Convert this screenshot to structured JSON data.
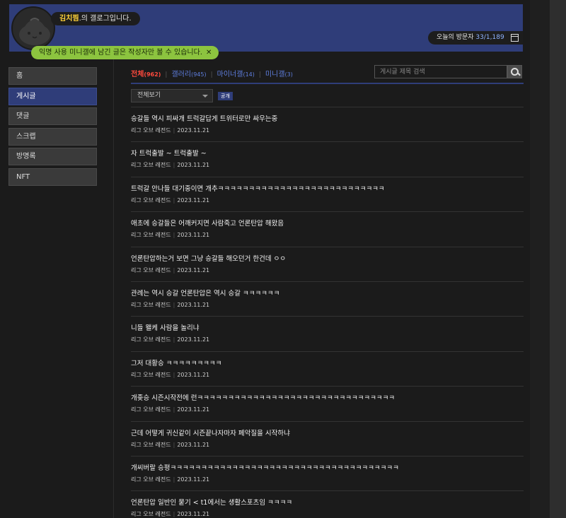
{
  "header": {
    "nickname": "김치찜",
    "gallog_suffix": ".의 갤로그입니다.",
    "visitor_label": "오늘의 방문자",
    "visitor_count": "33/1,189",
    "notice": "익명 사용 미니갤에 남긴 글은 작성자만 볼 수 있습니다.",
    "notice_close": "✕"
  },
  "nav": {
    "items": [
      {
        "label": "홈"
      },
      {
        "label": "게시글"
      },
      {
        "label": "댓글"
      },
      {
        "label": "스크랩"
      },
      {
        "label": "방명록"
      },
      {
        "label": "NFT"
      }
    ]
  },
  "tabs": [
    {
      "label": "전체",
      "count": "(962)"
    },
    {
      "label": "갤러리",
      "count": "(945)"
    },
    {
      "label": "마이너갤",
      "count": "(14)"
    },
    {
      "label": "미니갤",
      "count": "(3)"
    }
  ],
  "search": {
    "placeholder": "게시글 제목 검색"
  },
  "filter": {
    "selected": "전체보기",
    "badge": "공개"
  },
  "posts": [
    {
      "title": "승갈들 역시 피싸개 트럭갈답게 트위터로만 싸우는중",
      "gallery": "리그 오브 레전드",
      "date": "2023.11.21"
    },
    {
      "title": "자 트럭출발 ~ 트럭출발 ~",
      "gallery": "리그 오브 레전드",
      "date": "2023.11.21"
    },
    {
      "title": "트럭갈 안나들 대기중이면 개추ㅋㅋㅋㅋㅋㅋㅋㅋㅋㅋㅋㅋㅋㅋㅋㅋㅋㅋㅋㅋㅋㅋㅋㅋㅋㅋㅋ",
      "gallery": "리그 오브 레전드",
      "date": "2023.11.21"
    },
    {
      "title": "애초에 승갈들은 어깨커지면 사람죽고 언론탄압 해왔음",
      "gallery": "리그 오브 레전드",
      "date": "2023.11.21"
    },
    {
      "title": "언론탄압하는거 보면 그냥 승갈들 해오던거 한건데 ㅇㅇ",
      "gallery": "리그 오브 레전드",
      "date": "2023.11.21"
    },
    {
      "title": "관례는 역시 승갈 언론탄압은 역시 승갈 ㅋㅋㅋㅋㅋㅋ",
      "gallery": "리그 오브 레전드",
      "date": "2023.11.21"
    },
    {
      "title": "니들 왤케 사람을 놀리냐",
      "gallery": "리그 오브 레전드",
      "date": "2023.11.21"
    },
    {
      "title": "그저 대황승 ㅋㅋㅋㅋㅋㅋㅋㅋㅋ",
      "gallery": "리그 오브 레전드",
      "date": "2023.11.21"
    },
    {
      "title": "개좆승 시즌시작전에 런ㅋㅋㅋㅋㅋㅋㅋㅋㅋㅋㅋㅋㅋㅋㅋㅋㅋㅋㅋㅋㅋㅋㅋㅋㅋㅋㅋㅋㅋㅋㅋㅋ",
      "gallery": "리그 오브 레전드",
      "date": "2023.11.21"
    },
    {
      "title": "근데 어떻게 귀신같이 시즌끝나자마자 페악질을 시작하냐",
      "gallery": "리그 오브 레전드",
      "date": "2023.11.21"
    },
    {
      "title": "개씨버랄 승평ㅋㅋㅋㅋㅋㅋㅋㅋㅋㅋㅋㅋㅋㅋㅋㅋㅋㅋㅋㅋㅋㅋㅋㅋㅋㅋㅋㅋㅋㅋㅋㅋㅋㅋㅋㅋㅋ",
      "gallery": "리그 오브 레전드",
      "date": "2023.11.21"
    },
    {
      "title": "언론탄압 일반인 뭍기 < t1에서는 생활스포츠임 ㅋㅋㅋㅋ",
      "gallery": "리그 오브 레전드",
      "date": "2023.11.21"
    }
  ]
}
